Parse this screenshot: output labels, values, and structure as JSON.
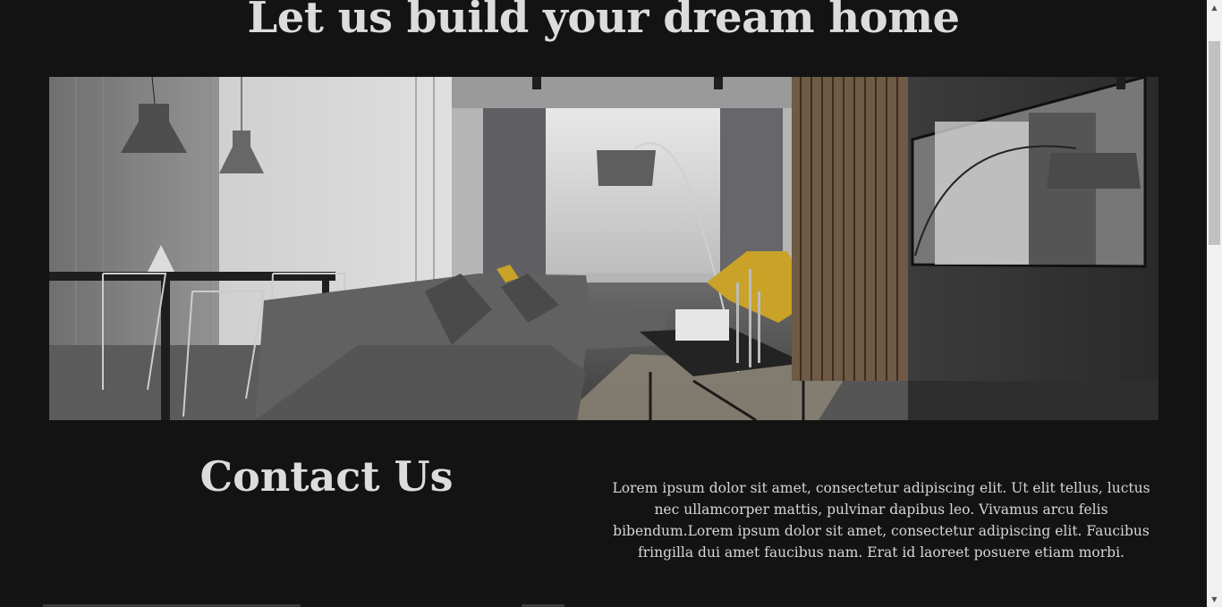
{
  "hero": {
    "title": "Let us build your dream home",
    "image_alt": "Modern grey living room with sofa, floor lamp and dining area"
  },
  "contact": {
    "title": "Contact Us",
    "text": "Lorem ipsum dolor sit amet, consectetur adipiscing elit. Ut elit tellus, luctus nec ullamcorper mattis, pulvinar dapibus leo. Vivamus arcu felis bibendum.Lorem ipsum dolor sit amet, consectetur adipiscing elit. Faucibus fringilla dui amet faucibus nam. Erat id laoreet posuere etiam morbi."
  },
  "scrollbar": {
    "up_icon": "triangle-up",
    "down_icon": "triangle-down"
  },
  "colors": {
    "background": "#131313",
    "heading": "#dcdcdc",
    "text": "#d6d6d6",
    "accent_chair": "#c9a227"
  }
}
